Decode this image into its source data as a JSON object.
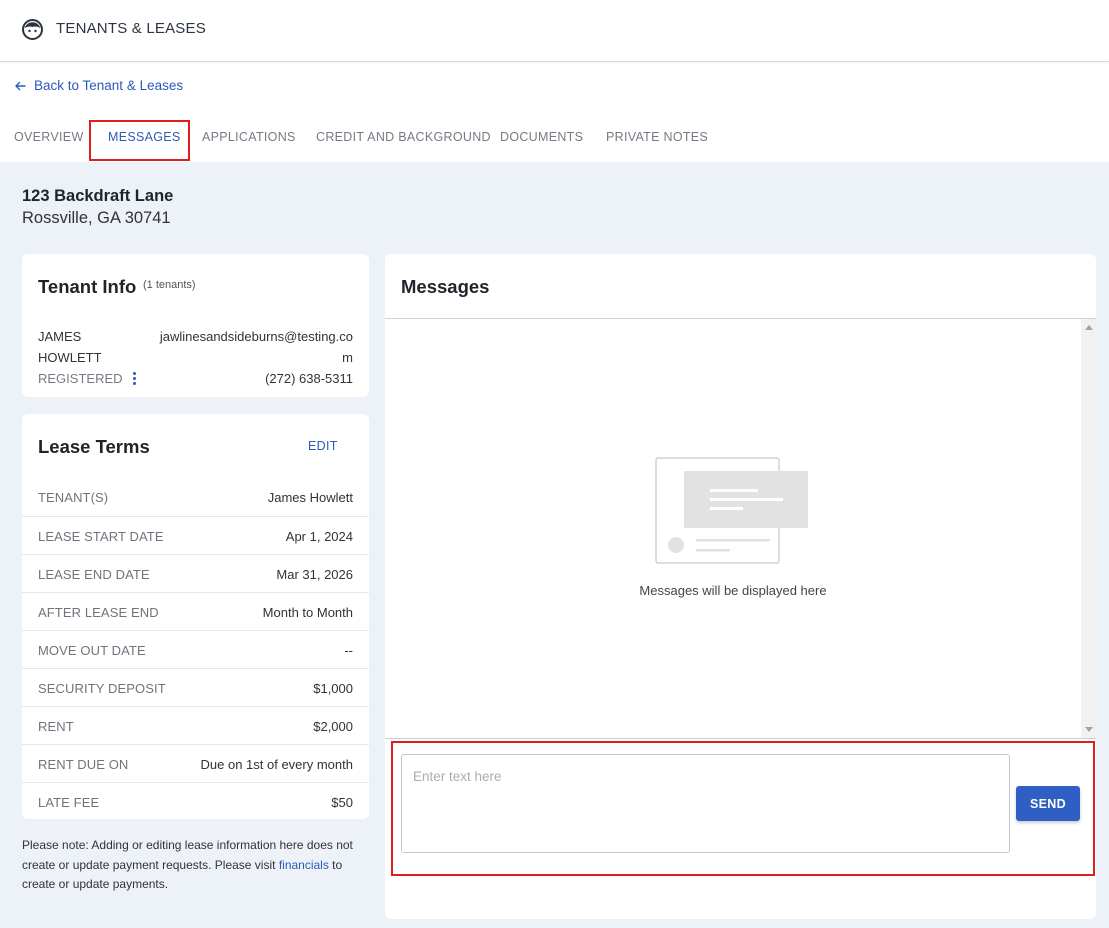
{
  "app": {
    "title": "TENANTS & LEASES",
    "icon": "face-icon"
  },
  "nav": {
    "back_label": "Back to Tenant & Leases"
  },
  "tabs": [
    {
      "label": "OVERVIEW"
    },
    {
      "label": "MESSAGES"
    },
    {
      "label": "APPLICATIONS"
    },
    {
      "label": "CREDIT AND BACKGROUND"
    },
    {
      "label": "DOCUMENTS"
    },
    {
      "label": "PRIVATE NOTES"
    }
  ],
  "active_tab": "MESSAGES",
  "property": {
    "line1": "123 Backdraft Lane",
    "line2": "Rossville, GA 30741"
  },
  "tenant_info": {
    "title": "Tenant Info",
    "count_label": "(1 tenants)",
    "first_name": "JAMES",
    "last_name": "HOWLETT",
    "email_line1": "jawlinesandsideburns@testing.co",
    "email_line2": "m",
    "status": "REGISTERED",
    "phone": "(272) 638-5311"
  },
  "lease_terms": {
    "title": "Lease Terms",
    "edit_label": "EDIT",
    "rows": [
      {
        "label": "TENANT(S)",
        "value": "James Howlett"
      },
      {
        "label": "LEASE START DATE",
        "value": "Apr 1, 2024"
      },
      {
        "label": "LEASE END DATE",
        "value": "Mar 31, 2026"
      },
      {
        "label": "AFTER LEASE END",
        "value": "Month to Month"
      },
      {
        "label": "MOVE OUT DATE",
        "value": "--"
      },
      {
        "label": "SECURITY DEPOSIT",
        "value": "$1,000"
      },
      {
        "label": "RENT",
        "value": "$2,000"
      },
      {
        "label": "RENT DUE ON",
        "value": "Due on 1st of every month"
      },
      {
        "label": "LATE FEE",
        "value": "$50"
      }
    ]
  },
  "note": {
    "text_before": "Please note: Adding or editing lease information here does not create or update payment requests. Please visit ",
    "link": "financials",
    "text_after": " to create or update payments."
  },
  "messages": {
    "title": "Messages",
    "empty_text": "Messages will be displayed here",
    "input_placeholder": "Enter text here",
    "input_value": "",
    "send_label": "SEND"
  },
  "colors": {
    "accent": "#2b5bb8",
    "highlight": "#e01d1d",
    "background": "#edf1f8",
    "send_button": "#2f5fc4"
  }
}
